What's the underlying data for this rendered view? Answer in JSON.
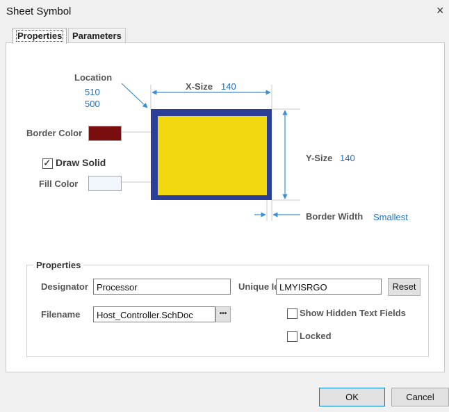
{
  "window": {
    "title": "Sheet Symbol",
    "close_glyph": "×"
  },
  "tabs": [
    {
      "label": "Properties"
    },
    {
      "label": "Parameters"
    }
  ],
  "graphic": {
    "location_label": "Location",
    "location_x": "510",
    "location_y": "500",
    "xsize_label": "X-Size",
    "xsize_value": "140",
    "ysize_label": "Y-Size",
    "ysize_value": "140",
    "border_color_label": "Border Color",
    "border_color": "#7a0e0e",
    "draw_solid_label": "Draw Solid",
    "draw_solid_checked": true,
    "fill_color_label": "Fill Color",
    "fill_color": "#f0f6fb",
    "border_width_label": "Border Width",
    "border_width_value": "Smallest",
    "symbol_border": "#2b3f96",
    "symbol_fill": "#f2d80f"
  },
  "properties": {
    "group_label": "Properties",
    "designator_label": "Designator",
    "designator_value": "Processor",
    "unique_id_label": "Unique Id",
    "unique_id_value": "LMYISRGO",
    "reset_label": "Reset",
    "filename_label": "Filename",
    "filename_value": "Host_Controller.SchDoc",
    "browse_label": "•••",
    "show_hidden_label": "Show Hidden Text Fields",
    "show_hidden_checked": false,
    "locked_label": "Locked",
    "locked_checked": false
  },
  "buttons": {
    "ok": "OK",
    "cancel": "Cancel"
  },
  "colors": {
    "accent": "#1f6fc5",
    "arrow": "#3a8fd8"
  }
}
